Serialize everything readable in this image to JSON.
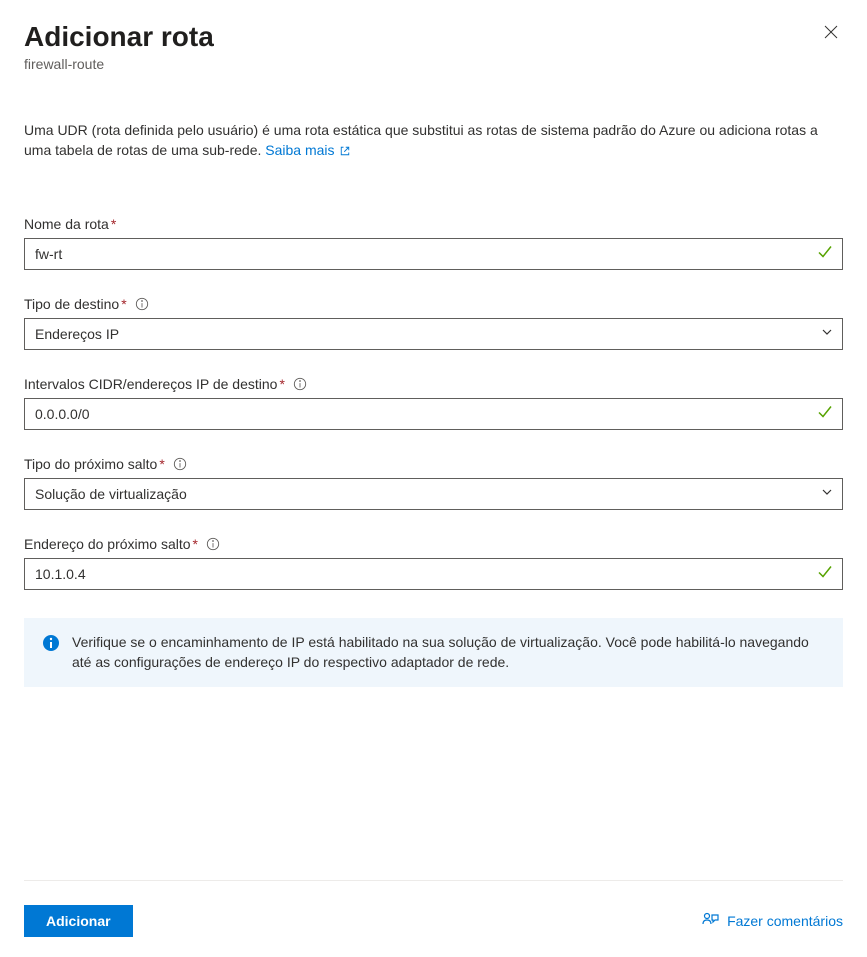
{
  "header": {
    "title": "Adicionar rota",
    "subtitle": "firewall-route"
  },
  "description": {
    "text": "Uma UDR (rota definida pelo usuário) é uma rota estática que substitui as rotas de sistema padrão do Azure ou adiciona rotas a uma tabela de rotas de uma sub-rede. ",
    "learn_more": "Saiba mais"
  },
  "fields": {
    "route_name": {
      "label": "Nome da rota",
      "value": "fw-rt"
    },
    "destination_type": {
      "label": "Tipo de destino",
      "value": "Endereços IP"
    },
    "cidr_ranges": {
      "label": "Intervalos CIDR/endereços IP de destino",
      "value": "0.0.0.0/0"
    },
    "next_hop_type": {
      "label": "Tipo do próximo salto",
      "value": "Solução de virtualização"
    },
    "next_hop_address": {
      "label": "Endereço do próximo salto",
      "value": "10.1.0.4"
    }
  },
  "info_box": {
    "text": "Verifique se o encaminhamento de IP está habilitado na sua solução de virtualização. Você pode habilitá-lo navegando até as configurações de endereço IP do respectivo adaptador de rede."
  },
  "footer": {
    "add_button": "Adicionar",
    "feedback_link": "Fazer comentários"
  }
}
